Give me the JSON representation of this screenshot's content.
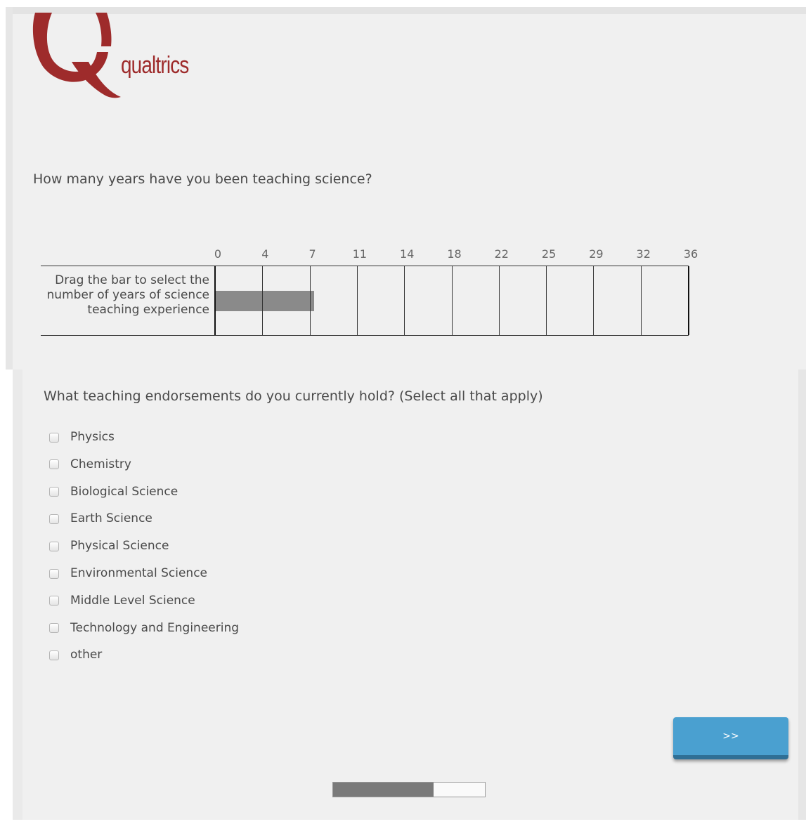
{
  "brand": {
    "name": "qualtrics",
    "color": "#9e2b2b"
  },
  "question1": {
    "text": "How many years have you been teaching science?",
    "scale_min": 0,
    "scale_max": 36,
    "ticks": [
      "0",
      "4",
      "7",
      "11",
      "14",
      "18",
      "22",
      "25",
      "29",
      "32",
      "36"
    ],
    "statement": "Drag the bar to select the number of years of science teaching experience",
    "value": 8
  },
  "question2": {
    "text": "What teaching endorsements do you currently hold? (Select all that apply)",
    "options": [
      "Physics",
      "Chemistry",
      "Biological Science",
      "Earth Science",
      "Physical Science",
      "Environmental Science",
      "Middle Level Science",
      "Technology and Engineering",
      "other"
    ]
  },
  "next_button": {
    "label": ">>",
    "color": "#4aa0d0"
  },
  "progress": {
    "fraction": 0.66
  }
}
